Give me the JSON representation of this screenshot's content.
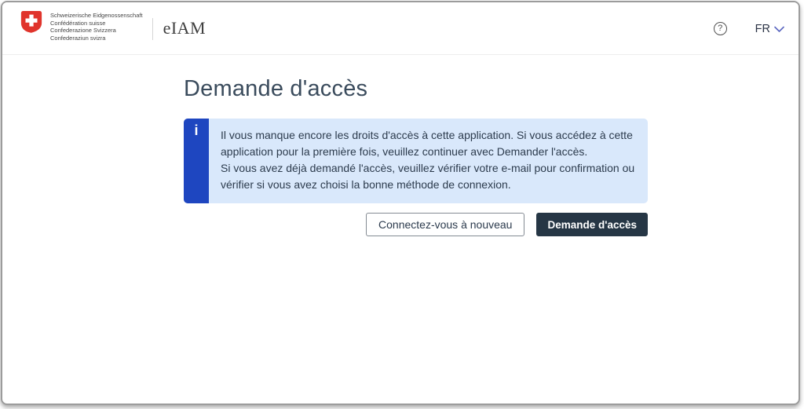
{
  "header": {
    "logo_lines": [
      "Schweizerische Eidgenossenschaft",
      "Confédération suisse",
      "Confederazione Svizzera",
      "Confederaziun svizra"
    ],
    "app_title": "eIAM",
    "help_label": "?",
    "language": {
      "code": "FR"
    }
  },
  "main": {
    "page_title": "Demande d'accès",
    "info_box": {
      "icon_glyph": "i",
      "paragraph1": "Il vous manque encore les droits d'accès à cette application. Si vous accédez à cette application pour la première fois, veuillez continuer avec Demander l'accès.",
      "paragraph2": "Si vous avez déjà demandé l'accès, veuillez vérifier votre e-mail pour confirmation ou vérifier si vous avez choisi la bonne méthode de connexion."
    },
    "actions": {
      "secondary_label": "Connectez-vous à nouveau",
      "primary_label": "Demande d'accès"
    }
  },
  "colors": {
    "swiss_red": "#e0342c",
    "info_accent": "#1e46c0",
    "info_background": "#d9e8fb",
    "primary_button": "#263645",
    "link_blue": "#5b67c0"
  }
}
